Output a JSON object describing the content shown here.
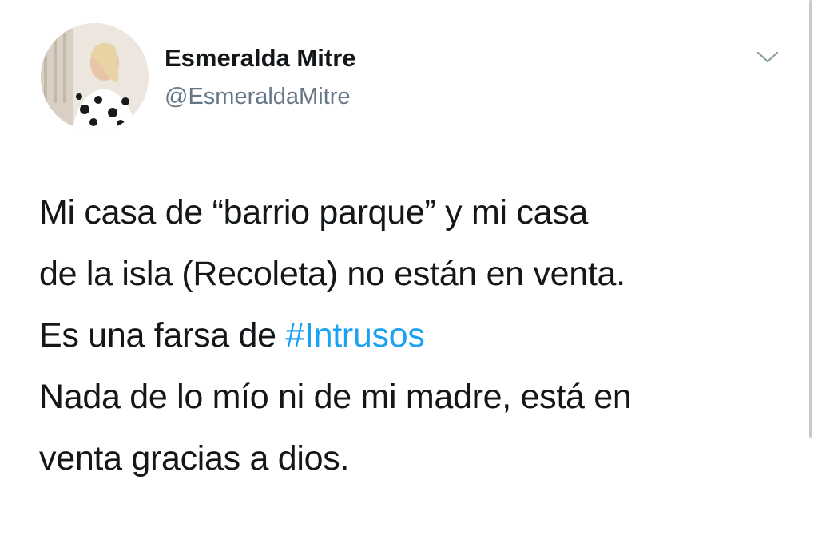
{
  "author": {
    "display_name": "Esmeralda Mitre",
    "handle": "@EsmeraldaMitre"
  },
  "icons": {
    "menu": "chevron-down-icon"
  },
  "tweet": {
    "lines": [
      "Mi casa de “barrio parque” y mi casa",
      "de la isla (Recoleta) no están en venta.",
      "Es una farsa de "
    ],
    "hashtag": "#Intrusos",
    "lines_after": [
      "Nada de lo mío ni de mi madre, está en",
      "venta gracias a dios."
    ]
  },
  "colors": {
    "text": "#14171a",
    "secondary": "#657786",
    "link": "#1da1f2",
    "background": "#ffffff"
  }
}
